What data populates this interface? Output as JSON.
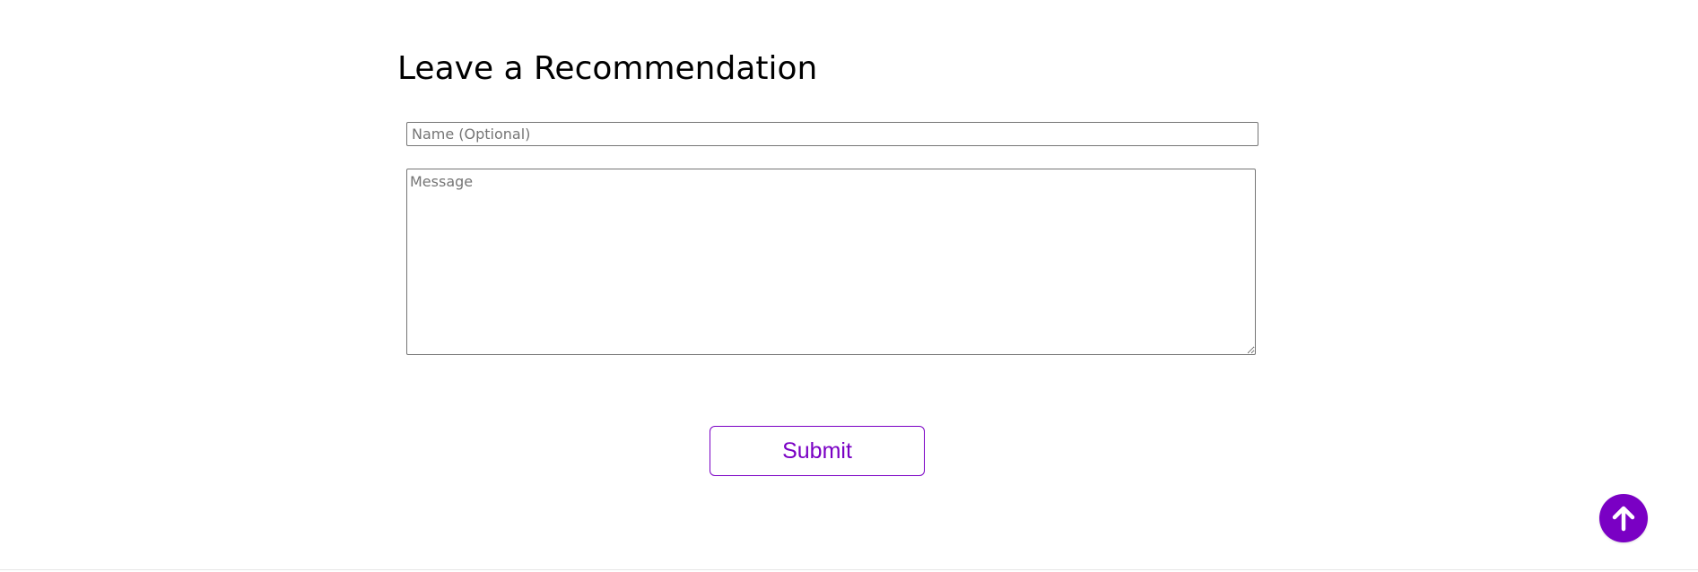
{
  "recommendation": {
    "title": "Leave a Recommendation",
    "name_placeholder": "Name (Optional)",
    "name_value": "",
    "message_placeholder": "Message",
    "message_value": "",
    "submit_label": "Submit"
  },
  "scroll_top": {
    "icon": "arrow-up-icon"
  },
  "colors": {
    "accent": "#7a00c4",
    "input_border": "#767676",
    "placeholder": "#757575",
    "background": "#ffffff"
  }
}
